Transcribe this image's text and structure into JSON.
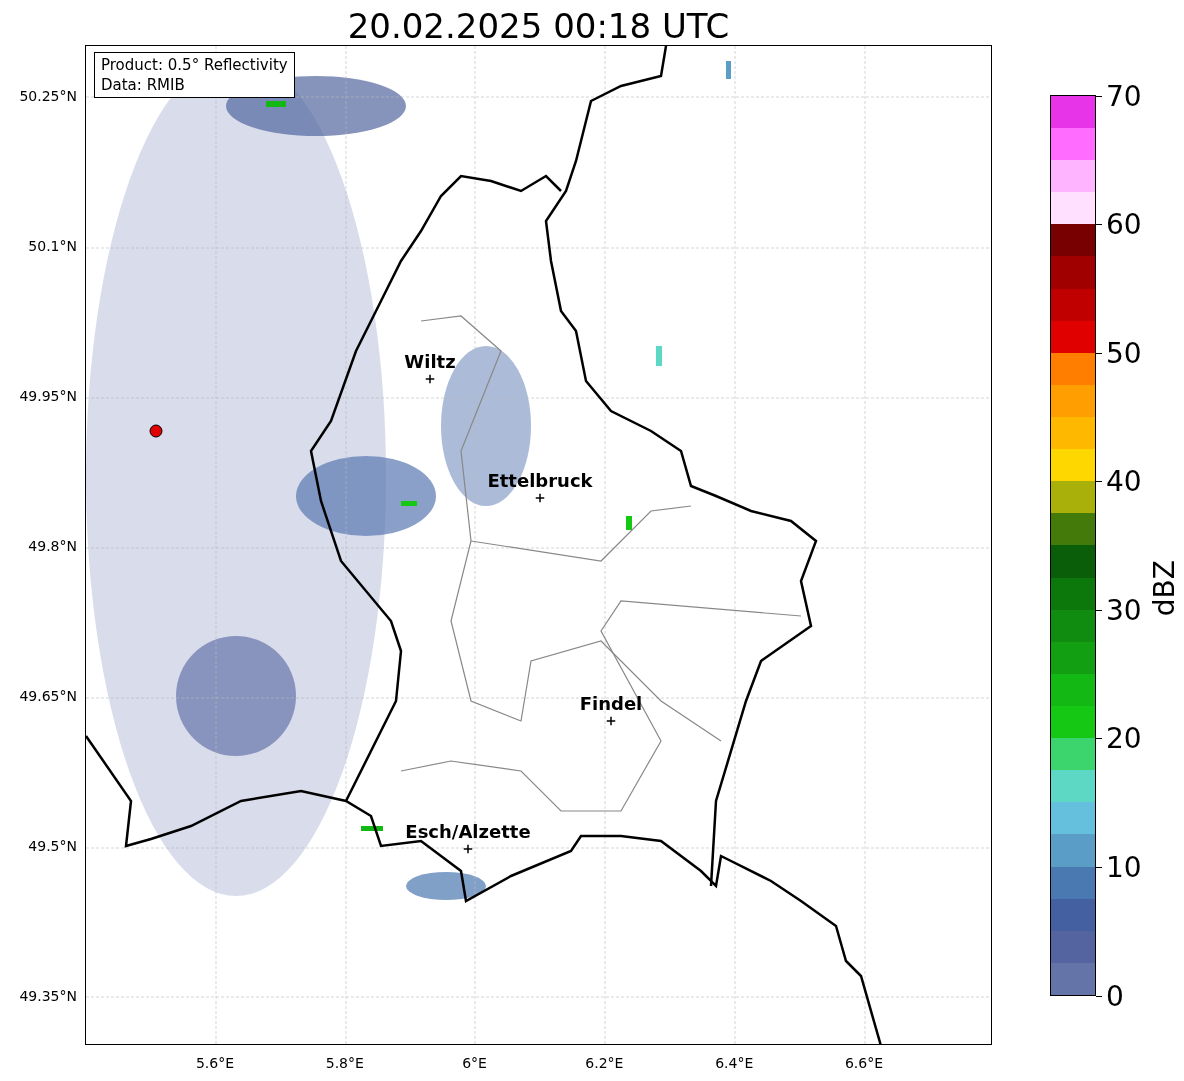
{
  "title": "20.02.2025 00:18 UTC",
  "info_box": {
    "product": "Product: 0.5° Reflectivity",
    "source": "Data: RMIB"
  },
  "map": {
    "cities": [
      {
        "name": "Wiltz"
      },
      {
        "name": "Ettelbruck"
      },
      {
        "name": "Findel"
      },
      {
        "name": "Esch/Alzette"
      }
    ],
    "yticks": [
      "50.25°N",
      "50.1°N",
      "49.95°N",
      "49.8°N",
      "49.65°N",
      "49.5°N",
      "49.35°N"
    ],
    "xticks": [
      "5.6°E",
      "5.8°E",
      "6°E",
      "6.2°E",
      "6.4°E",
      "6.6°E"
    ]
  },
  "colorbar": {
    "label": "dBZ",
    "ticks": [
      "70",
      "60",
      "50",
      "40",
      "30",
      "20",
      "10",
      "0"
    ],
    "segments": [
      {
        "color": "#6474a8"
      },
      {
        "color": "#5364a0"
      },
      {
        "color": "#4560a0"
      },
      {
        "color": "#4a78b0"
      },
      {
        "color": "#5a9ec8"
      },
      {
        "color": "#64c0dc"
      },
      {
        "color": "#5cd8c4"
      },
      {
        "color": "#3cd46c"
      },
      {
        "color": "#14c814"
      },
      {
        "color": "#14b814"
      },
      {
        "color": "#12a012"
      },
      {
        "color": "#108c10"
      },
      {
        "color": "#0c780c"
      },
      {
        "color": "#0a5e0a"
      },
      {
        "color": "#447a0a"
      },
      {
        "color": "#aab00a"
      },
      {
        "color": "#ffd700"
      },
      {
        "color": "#ffb800"
      },
      {
        "color": "#ff9e00"
      },
      {
        "color": "#ff7e00"
      },
      {
        "color": "#e00000"
      },
      {
        "color": "#c00000"
      },
      {
        "color": "#a00000"
      },
      {
        "color": "#780000"
      },
      {
        "color": "#ffe0ff"
      },
      {
        "color": "#ffb4ff"
      },
      {
        "color": "#ff6cff"
      },
      {
        "color": "#e834e8"
      }
    ]
  }
}
